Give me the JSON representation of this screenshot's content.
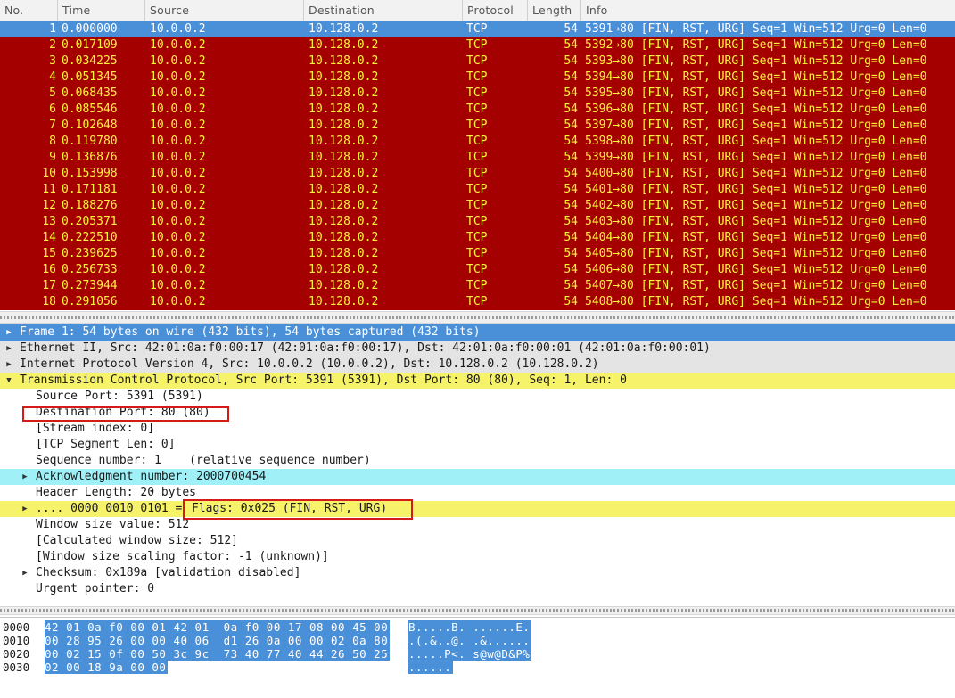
{
  "packet_list": {
    "columns": [
      "No.",
      "Time",
      "Source",
      "Destination",
      "Protocol",
      "Length",
      "Info"
    ],
    "rows": [
      {
        "no": "1",
        "time": "0.000000",
        "src": "10.0.0.2",
        "dst": "10.128.0.2",
        "proto": "TCP",
        "len": "54",
        "info": "5391→80 [FIN, RST, URG] Seq=1 Win=512 Urg=0 Len=0"
      },
      {
        "no": "2",
        "time": "0.017109",
        "src": "10.0.0.2",
        "dst": "10.128.0.2",
        "proto": "TCP",
        "len": "54",
        "info": "5392→80 [FIN, RST, URG] Seq=1 Win=512 Urg=0 Len=0"
      },
      {
        "no": "3",
        "time": "0.034225",
        "src": "10.0.0.2",
        "dst": "10.128.0.2",
        "proto": "TCP",
        "len": "54",
        "info": "5393→80 [FIN, RST, URG] Seq=1 Win=512 Urg=0 Len=0"
      },
      {
        "no": "4",
        "time": "0.051345",
        "src": "10.0.0.2",
        "dst": "10.128.0.2",
        "proto": "TCP",
        "len": "54",
        "info": "5394→80 [FIN, RST, URG] Seq=1 Win=512 Urg=0 Len=0"
      },
      {
        "no": "5",
        "time": "0.068435",
        "src": "10.0.0.2",
        "dst": "10.128.0.2",
        "proto": "TCP",
        "len": "54",
        "info": "5395→80 [FIN, RST, URG] Seq=1 Win=512 Urg=0 Len=0"
      },
      {
        "no": "6",
        "time": "0.085546",
        "src": "10.0.0.2",
        "dst": "10.128.0.2",
        "proto": "TCP",
        "len": "54",
        "info": "5396→80 [FIN, RST, URG] Seq=1 Win=512 Urg=0 Len=0"
      },
      {
        "no": "7",
        "time": "0.102648",
        "src": "10.0.0.2",
        "dst": "10.128.0.2",
        "proto": "TCP",
        "len": "54",
        "info": "5397→80 [FIN, RST, URG] Seq=1 Win=512 Urg=0 Len=0"
      },
      {
        "no": "8",
        "time": "0.119780",
        "src": "10.0.0.2",
        "dst": "10.128.0.2",
        "proto": "TCP",
        "len": "54",
        "info": "5398→80 [FIN, RST, URG] Seq=1 Win=512 Urg=0 Len=0"
      },
      {
        "no": "9",
        "time": "0.136876",
        "src": "10.0.0.2",
        "dst": "10.128.0.2",
        "proto": "TCP",
        "len": "54",
        "info": "5399→80 [FIN, RST, URG] Seq=1 Win=512 Urg=0 Len=0"
      },
      {
        "no": "10",
        "time": "0.153998",
        "src": "10.0.0.2",
        "dst": "10.128.0.2",
        "proto": "TCP",
        "len": "54",
        "info": "5400→80 [FIN, RST, URG] Seq=1 Win=512 Urg=0 Len=0"
      },
      {
        "no": "11",
        "time": "0.171181",
        "src": "10.0.0.2",
        "dst": "10.128.0.2",
        "proto": "TCP",
        "len": "54",
        "info": "5401→80 [FIN, RST, URG] Seq=1 Win=512 Urg=0 Len=0"
      },
      {
        "no": "12",
        "time": "0.188276",
        "src": "10.0.0.2",
        "dst": "10.128.0.2",
        "proto": "TCP",
        "len": "54",
        "info": "5402→80 [FIN, RST, URG] Seq=1 Win=512 Urg=0 Len=0"
      },
      {
        "no": "13",
        "time": "0.205371",
        "src": "10.0.0.2",
        "dst": "10.128.0.2",
        "proto": "TCP",
        "len": "54",
        "info": "5403→80 [FIN, RST, URG] Seq=1 Win=512 Urg=0 Len=0"
      },
      {
        "no": "14",
        "time": "0.222510",
        "src": "10.0.0.2",
        "dst": "10.128.0.2",
        "proto": "TCP",
        "len": "54",
        "info": "5404→80 [FIN, RST, URG] Seq=1 Win=512 Urg=0 Len=0"
      },
      {
        "no": "15",
        "time": "0.239625",
        "src": "10.0.0.2",
        "dst": "10.128.0.2",
        "proto": "TCP",
        "len": "54",
        "info": "5405→80 [FIN, RST, URG] Seq=1 Win=512 Urg=0 Len=0"
      },
      {
        "no": "16",
        "time": "0.256733",
        "src": "10.0.0.2",
        "dst": "10.128.0.2",
        "proto": "TCP",
        "len": "54",
        "info": "5406→80 [FIN, RST, URG] Seq=1 Win=512 Urg=0 Len=0"
      },
      {
        "no": "17",
        "time": "0.273944",
        "src": "10.0.0.2",
        "dst": "10.128.0.2",
        "proto": "TCP",
        "len": "54",
        "info": "5407→80 [FIN, RST, URG] Seq=1 Win=512 Urg=0 Len=0"
      },
      {
        "no": "18",
        "time": "0.291056",
        "src": "10.0.0.2",
        "dst": "10.128.0.2",
        "proto": "TCP",
        "len": "54",
        "info": "5408→80 [FIN, RST, URG] Seq=1 Win=512 Urg=0 Len=0"
      }
    ],
    "selected_row": "1"
  },
  "detail_tree": {
    "frame": "Frame 1: 54 bytes on wire (432 bits), 54 bytes captured (432 bits)",
    "ethernet": "Ethernet II, Src: 42:01:0a:f0:00:17 (42:01:0a:f0:00:17), Dst: 42:01:0a:f0:00:01 (42:01:0a:f0:00:01)",
    "ip": "Internet Protocol Version 4, Src: 10.0.0.2 (10.0.0.2), Dst: 10.128.0.2 (10.128.0.2)",
    "tcp": "Transmission Control Protocol, Src Port: 5391 (5391), Dst Port: 80 (80), Seq: 1, Len: 0",
    "tcp_fields": {
      "src_port": "Source Port: 5391 (5391)",
      "dst_port": "Destination Port: 80 (80)",
      "stream_index": "[Stream index: 0]",
      "segment_len": "[TCP Segment Len: 0]",
      "seq": "Sequence number: 1    (relative sequence number)",
      "ack": "Acknowledgment number: 2000700454",
      "header_len": "Header Length: 20 bytes",
      "flags_prefix": ".... 0000 0010 0101 =",
      "flags_value": "Flags: 0x025 (FIN, RST, URG)",
      "window": "Window size value: 512",
      "calc_window": "[Calculated window size: 512]",
      "scaling": "[Window size scaling factor: -1 (unknown)]",
      "checksum": "Checksum: 0x189a [validation disabled]",
      "urgent": "Urgent pointer: 0"
    },
    "icons": {
      "collapsed": "triangle-right-icon",
      "expanded": "triangle-down-icon"
    }
  },
  "hex_pane": {
    "lines": [
      {
        "offset": "0000",
        "bytes": "42 01 0a f0 00 01 42 01  0a f0 00 17 08 00 45 00",
        "ascii": "B.....B. ......E."
      },
      {
        "offset": "0010",
        "bytes": "00 28 95 26 00 00 40 06  d1 26 0a 00 00 02 0a 80",
        "ascii": ".(.&..@. .&......"
      },
      {
        "offset": "0020",
        "bytes": "00 02 15 0f 00 50 3c 9c  73 40 77 40 44 26 50 25",
        "ascii": ".....P<. s@w@D&P%"
      },
      {
        "offset": "0030",
        "bytes": "02 00 18 9a 00 00",
        "ascii": "......"
      }
    ]
  },
  "colors": {
    "row_bad_tcp_bg": "#a40000",
    "row_bad_tcp_fg": "#fef23c",
    "selection": "#4a90d9",
    "tcp_highlight": "#f6f269",
    "ack_highlight": "#a0f0f8",
    "annotation_box": "#d51a1a"
  }
}
